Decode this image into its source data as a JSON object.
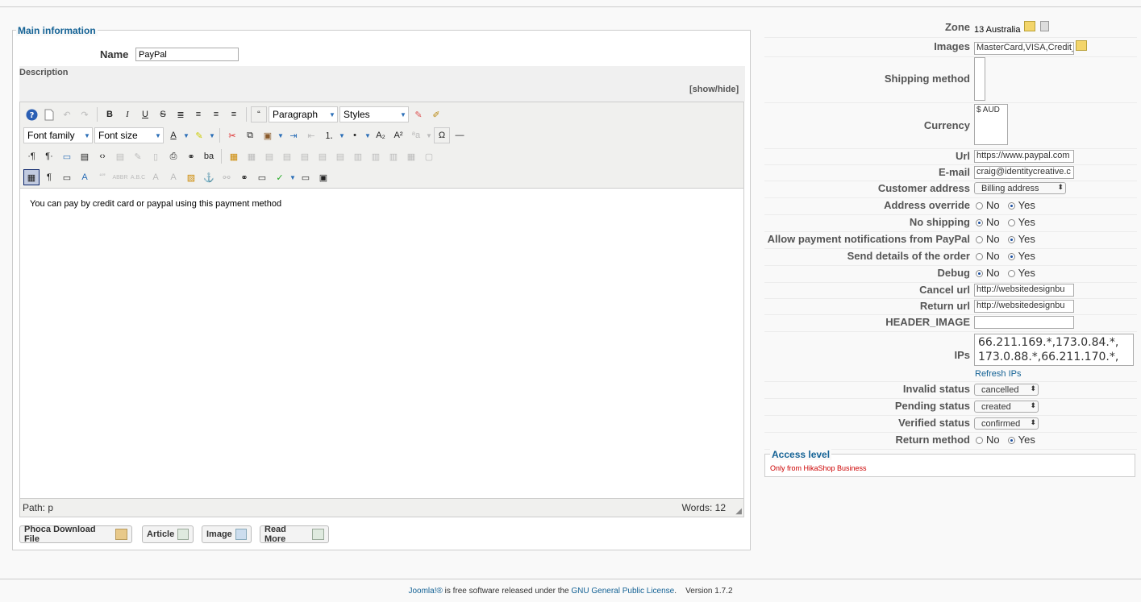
{
  "main": {
    "legend": "Main information",
    "name_label": "Name",
    "name_value": "PayPal",
    "description_label": "Description",
    "show_hide": "[show/hide]"
  },
  "editor": {
    "format_select": "Paragraph",
    "styles_select": "Styles",
    "font_family": "Font family",
    "font_size": "Font size",
    "content": "You can pay by credit card or paypal using this payment method",
    "path_label": "Path:",
    "path_value": "p",
    "words": "Words: 12"
  },
  "xtd_buttons": [
    "Phoca Download File",
    "Article",
    "Image",
    "Read More"
  ],
  "params": {
    "zone_label": "Zone",
    "zone_value": "13 Australia",
    "images_label": "Images",
    "images_value": "MasterCard,VISA,Credit_",
    "shipping_label": "Shipping method",
    "currency_label": "Currency",
    "currency_value": "$ AUD",
    "url_label": "Url",
    "url_value": "https://www.paypal.com",
    "email_label": "E-mail",
    "email_value": "craig@identitycreative.c",
    "customer_address_label": "Customer address",
    "customer_address_value": "Billing address",
    "address_override_label": "Address override",
    "no_shipping_label": "No shipping",
    "allow_notif_label": "Allow payment notifications from PayPal",
    "send_details_label": "Send details of the order",
    "debug_label": "Debug",
    "radio_no": "No",
    "radio_yes": "Yes",
    "cancel_url_label": "Cancel url",
    "cancel_url_value": "http://websitedesignbu",
    "return_url_label": "Return url",
    "return_url_value": "http://websitedesignbu",
    "header_image_label": "HEADER_IMAGE",
    "header_image_value": "",
    "ips_label": "IPs",
    "ips_line1": "66.211.169.*,173.0.84.*,",
    "ips_line2": "173.0.88.*,66.211.170.*,",
    "refresh_ips": "Refresh IPs",
    "invalid_status_label": "Invalid status",
    "invalid_status_value": "cancelled",
    "pending_status_label": "Pending status",
    "pending_status_value": "created",
    "verified_status_label": "Verified status",
    "verified_status_value": "confirmed",
    "return_method_label": "Return method"
  },
  "access": {
    "legend": "Access level",
    "value": "Only from HikaShop Business"
  },
  "footer": {
    "joomla": "Joomla!®",
    "text": " is free software released under the ",
    "license": "GNU General Public License",
    "version": "Version 1.7.2"
  }
}
